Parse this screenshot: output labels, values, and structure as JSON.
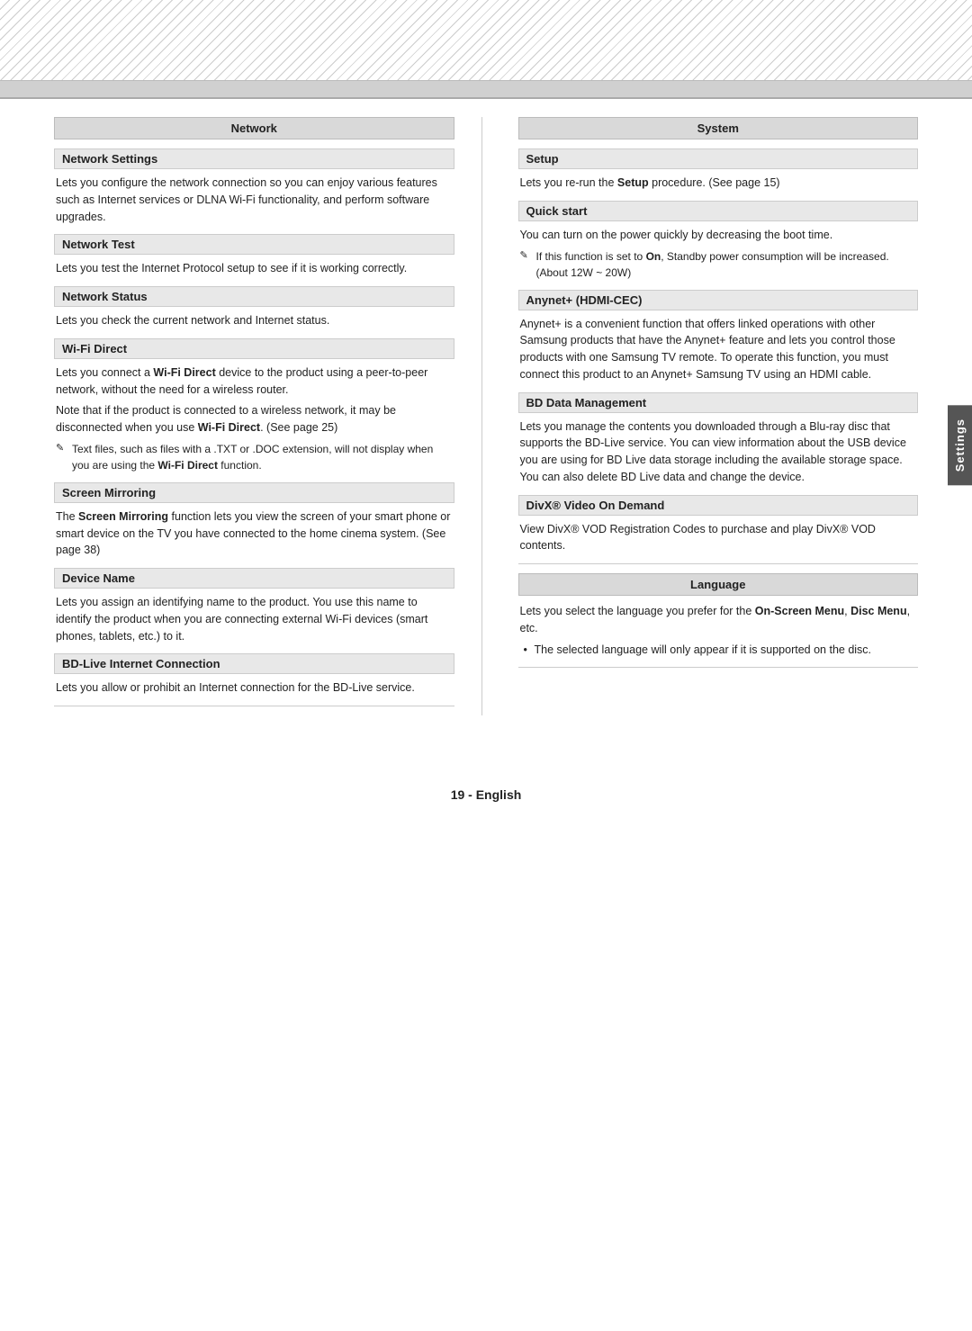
{
  "page": {
    "footer": "19 - English",
    "settings_tab_label": "Settings"
  },
  "top_pattern": {
    "visible": true
  },
  "left_column": {
    "section_header": "Network",
    "subsections": [
      {
        "id": "network-settings",
        "header": "Network Settings",
        "body": "Lets you configure the network connection so you can enjoy various features such as Internet services or DLNA Wi-Fi functionality, and perform software upgrades."
      },
      {
        "id": "network-test",
        "header": "Network Test",
        "body": "Lets you test the Internet Protocol setup to see if it is working correctly."
      },
      {
        "id": "network-status",
        "header": "Network Status",
        "body": "Lets you check the current network and Internet status."
      },
      {
        "id": "wifi-direct",
        "header": "Wi-Fi Direct",
        "body_parts": [
          "Lets you connect a <strong>Wi-Fi Direct</strong> device to the product using a peer-to-peer network, without the need for a wireless router.",
          "Note that if the product is connected to a wireless network, it may be disconnected when you use <strong>Wi-Fi Direct</strong>. (See page 25)"
        ],
        "note": "Text files, such as files with a .TXT or .DOC extension, will not display when you are using the <strong>Wi-Fi Direct</strong> function."
      },
      {
        "id": "screen-mirroring",
        "header": "Screen Mirroring",
        "body": "The <strong>Screen Mirroring</strong> function lets you view the screen of your smart phone or smart device on the TV you have connected to the home cinema system. (See page 38)"
      },
      {
        "id": "device-name",
        "header": "Device Name",
        "body": "Lets you assign an identifying name to the product. You use this name to identify the product when you are connecting external Wi-Fi devices (smart phones, tablets, etc.) to it."
      },
      {
        "id": "bd-live-internet",
        "header": "BD-Live Internet Connection",
        "body": "Lets you allow or prohibit an Internet connection for the BD-Live service."
      }
    ]
  },
  "right_column": {
    "section_header": "System",
    "subsections": [
      {
        "id": "setup",
        "header": "Setup",
        "body": "Lets you re-run the <strong>Setup</strong> procedure. (See page 15)"
      },
      {
        "id": "quick-start",
        "header": "Quick start",
        "body_parts": [
          "You can turn on the power quickly by decreasing the boot time."
        ],
        "note": "If this function is set to <strong>On</strong>, Standby power consumption will be increased. (About 12W ~ 20W)"
      },
      {
        "id": "anynet",
        "header": "Anynet+ (HDMI-CEC)",
        "body": "Anynet+ is a convenient function that offers linked operations with other Samsung products that have the Anynet+ feature and lets you control those products with one Samsung TV remote. To operate this function, you must connect this product to an Anynet+ Samsung TV using an HDMI cable."
      },
      {
        "id": "bd-data",
        "header": "BD Data Management",
        "body": "Lets you manage the contents you downloaded through a Blu-ray disc that supports the BD-Live service. You can view information about the USB device you are using for BD Live data storage including the available storage space. You can also delete BD Live data and change the device."
      },
      {
        "id": "divx",
        "header": "DivX® Video On Demand",
        "body": "View DivX® VOD Registration Codes to purchase and play DivX® VOD contents."
      }
    ],
    "language_section": {
      "header": "Language",
      "body": "Lets you select the language you prefer for the <strong>On-Screen Menu</strong>, <strong>Disc Menu</strong>, etc.",
      "bullet": "The selected language will only appear if it is supported on the disc."
    }
  }
}
